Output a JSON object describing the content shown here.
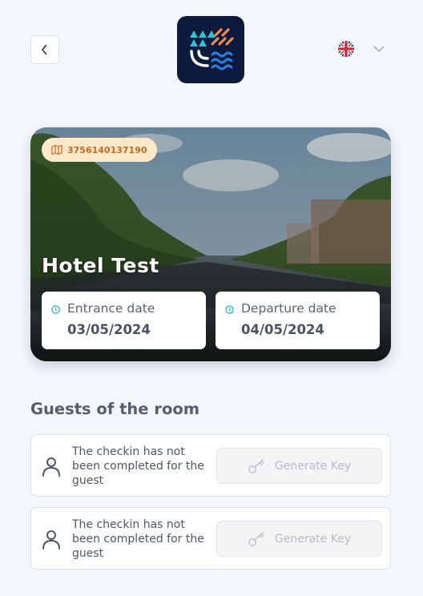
{
  "header": {
    "back_icon": "chevron-left-icon",
    "logo": "app-logo",
    "language": {
      "flag": "uk-flag-icon",
      "dropdown_icon": "chevron-down-icon"
    }
  },
  "reservation": {
    "booking_code": "3756140137190",
    "hotel_name": "Hotel Test",
    "entrance": {
      "label": "Entrance date",
      "value": "03/05/2024"
    },
    "departure": {
      "label": "Departure date",
      "value": "04/05/2024"
    }
  },
  "guests_section": {
    "title": "Guests of the room",
    "guests": [
      {
        "status": "The checkin has not been completed for the guest",
        "button_label": "Generate Key"
      },
      {
        "status": "The checkin has not been completed for the guest",
        "button_label": "Generate Key"
      }
    ]
  },
  "colors": {
    "background": "#f4f7fc",
    "logo_bg": "#0b1a3d",
    "badge_bg": "#fde8c8",
    "badge_text": "#c4692a",
    "accent_teal": "#2bb3c9"
  }
}
